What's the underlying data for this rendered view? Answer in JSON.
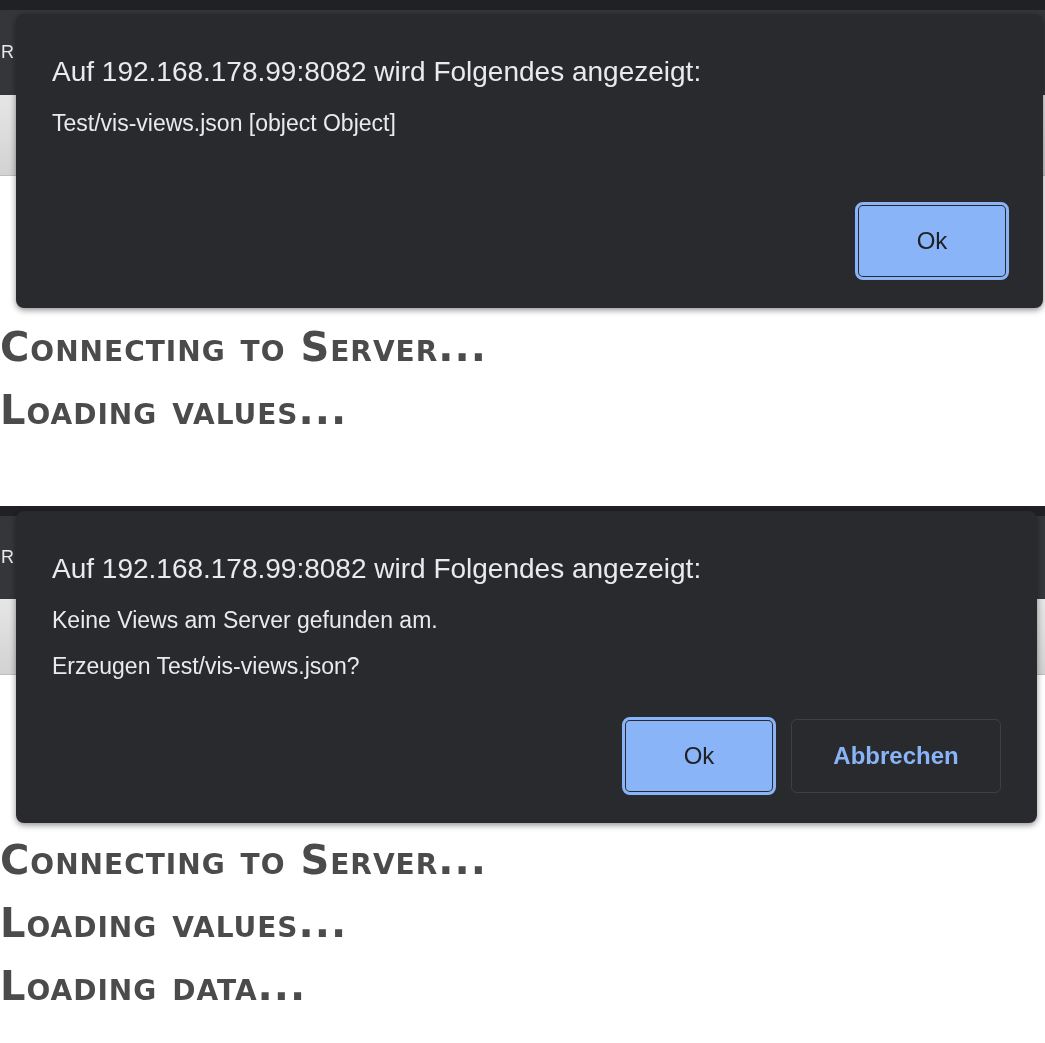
{
  "screens": [
    {
      "tab_letter": "R",
      "dialog": {
        "title": "Auf 192.168.178.99:8082 wird Folgendes angezeigt:",
        "message_lines": [
          "Test/vis-views.json [object Object]"
        ],
        "buttons": [
          {
            "label": "Ok",
            "kind": "primary"
          }
        ]
      },
      "status_lines": [
        "Connecting to Server...",
        "Loading values..."
      ]
    },
    {
      "tab_letter": "R",
      "dialog": {
        "title": "Auf 192.168.178.99:8082 wird Folgendes angezeigt:",
        "message_lines": [
          "Keine Views am Server gefunden am.",
          "Erzeugen Test/vis-views.json?"
        ],
        "buttons": [
          {
            "label": "Ok",
            "kind": "primary"
          },
          {
            "label": "Abbrechen",
            "kind": "secondary"
          }
        ]
      },
      "status_lines": [
        "Connecting to Server...",
        "Loading values...",
        "Loading data..."
      ]
    }
  ]
}
